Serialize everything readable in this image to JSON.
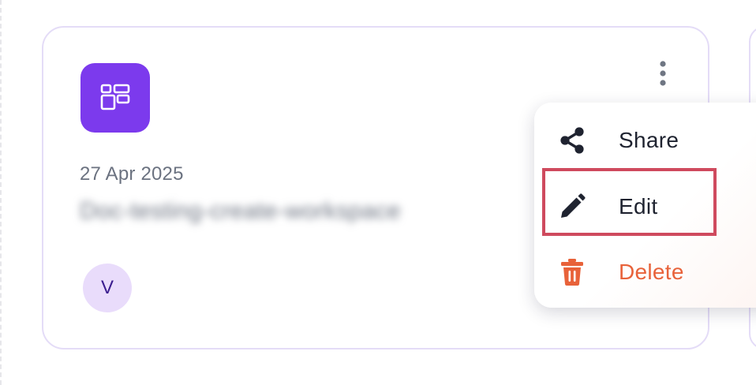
{
  "card": {
    "icon": "grid-layout-icon",
    "date": "27 Apr 2025",
    "title": "Doc-testing-create-workspace",
    "avatar_initial": "V",
    "more_icon": "vertical-dots-icon"
  },
  "menu": {
    "items": [
      {
        "label": "Share",
        "icon": "share-icon"
      },
      {
        "label": "Edit",
        "icon": "pencil-icon"
      },
      {
        "label": "Delete",
        "icon": "trash-icon"
      }
    ]
  },
  "colors": {
    "accent": "#7c3aed",
    "card_border": "#e4dcf7",
    "avatar_bg": "#e9dcfb",
    "delete": "#e8623a",
    "highlight": "#cf4a5e",
    "muted_text": "#6b7280"
  }
}
